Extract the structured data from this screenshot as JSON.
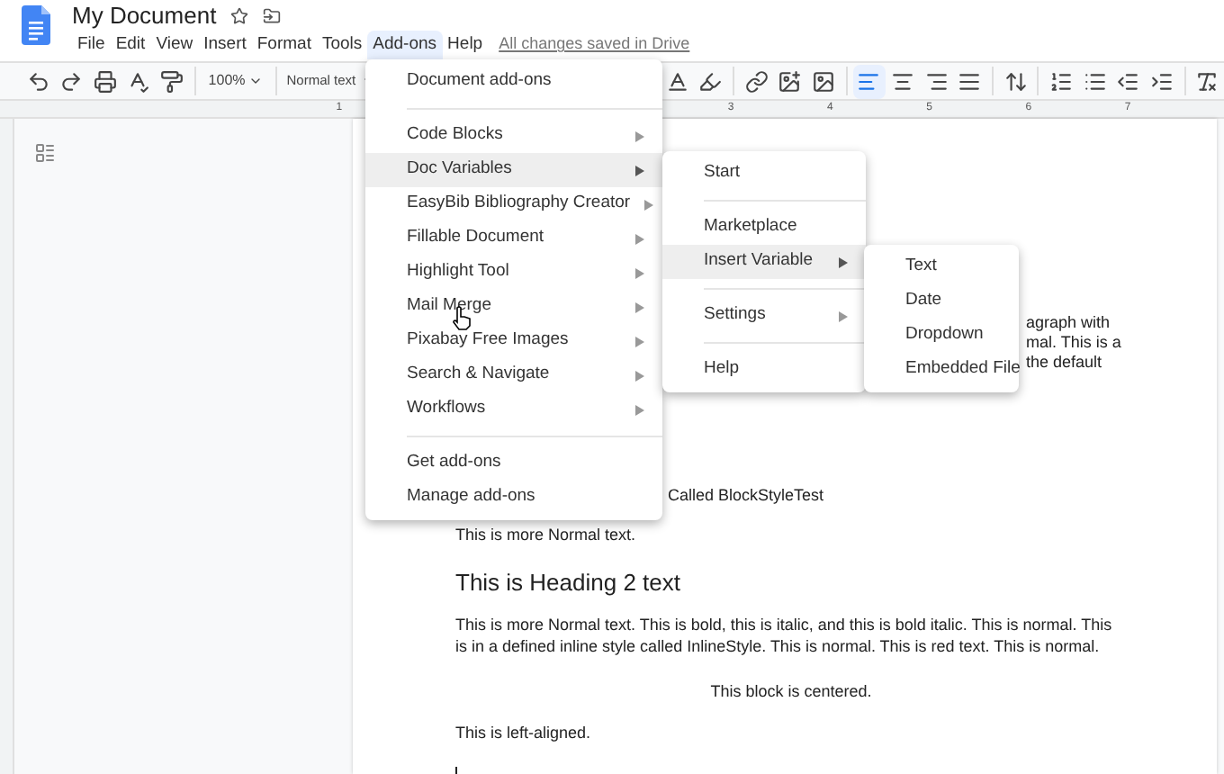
{
  "document_title": "My Document",
  "menu_bar": [
    {
      "label": "File",
      "selected": false
    },
    {
      "label": "Edit",
      "selected": false
    },
    {
      "label": "View",
      "selected": false
    },
    {
      "label": "Insert",
      "selected": false
    },
    {
      "label": "Format",
      "selected": false
    },
    {
      "label": "Tools",
      "selected": false
    },
    {
      "label": "Add-ons",
      "selected": true
    },
    {
      "label": "Help",
      "selected": false
    }
  ],
  "save_status": "All changes saved in Drive",
  "toolbar": {
    "zoom": "100%",
    "style": "Normal text",
    "alignments": [
      {
        "kind": "left",
        "selected": true
      },
      {
        "kind": "center",
        "selected": false
      },
      {
        "kind": "right",
        "selected": false
      },
      {
        "kind": "justify",
        "selected": false
      }
    ]
  },
  "ruler_labels": [
    "1",
    "3",
    "4",
    "5",
    "6",
    "7"
  ],
  "document": {
    "fragments": [
      "agraph with",
      "mal. This is a",
      "the default"
    ],
    "lines": [
      {
        "kind": "partial",
        "text": "Called BlockStyleTest"
      },
      {
        "kind": "normal",
        "text": "This is more Normal text."
      },
      {
        "kind": "heading",
        "text": "This is Heading 2 text"
      },
      {
        "kind": "normal",
        "text": "This is more Normal text. This is bold, this is italic, and this is bold italic. This is normal. This is in a defined inline style called InlineStyle. This is normal. This is red text. This is normal."
      },
      {
        "kind": "centered",
        "text": "This block is centered."
      },
      {
        "kind": "normal",
        "text": "This is left-aligned."
      }
    ]
  },
  "addons_menu": [
    {
      "kind": "item",
      "label": "Document add-ons",
      "submenu": false,
      "selected": false
    },
    {
      "kind": "separator"
    },
    {
      "kind": "item",
      "label": "Code Blocks",
      "submenu": true,
      "selected": false
    },
    {
      "kind": "item",
      "label": "Doc Variables",
      "submenu": true,
      "selected": true
    },
    {
      "kind": "item",
      "label": "EasyBib Bibliography Creator",
      "submenu": true,
      "selected": false
    },
    {
      "kind": "item",
      "label": "Fillable Document",
      "submenu": true,
      "selected": false
    },
    {
      "kind": "item",
      "label": "Highlight Tool",
      "submenu": true,
      "selected": false
    },
    {
      "kind": "item",
      "label": "Mail Merge",
      "submenu": true,
      "selected": false
    },
    {
      "kind": "item",
      "label": "Pixabay Free Images",
      "submenu": true,
      "selected": false
    },
    {
      "kind": "item",
      "label": "Search & Navigate",
      "submenu": true,
      "selected": false
    },
    {
      "kind": "item",
      "label": "Workflows",
      "submenu": true,
      "selected": false
    },
    {
      "kind": "separator"
    },
    {
      "kind": "item",
      "label": "Get add-ons",
      "submenu": false,
      "selected": false
    },
    {
      "kind": "item",
      "label": "Manage add-ons",
      "submenu": false,
      "selected": false
    }
  ],
  "doc_variables_menu": [
    {
      "kind": "item",
      "label": "Start",
      "submenu": false,
      "selected": false
    },
    {
      "kind": "separator"
    },
    {
      "kind": "item",
      "label": "Marketplace",
      "submenu": false,
      "selected": false
    },
    {
      "kind": "item",
      "label": "Insert Variable",
      "submenu": true,
      "selected": true
    },
    {
      "kind": "separator"
    },
    {
      "kind": "item",
      "label": "Settings",
      "submenu": true,
      "selected": false
    },
    {
      "kind": "separator"
    },
    {
      "kind": "item",
      "label": "Help",
      "submenu": false,
      "selected": false
    }
  ],
  "insert_variable_menu": [
    {
      "kind": "item",
      "label": "Text",
      "selected": false
    },
    {
      "kind": "item",
      "label": "Date",
      "selected": false
    },
    {
      "kind": "item",
      "label": "Dropdown",
      "selected": false
    },
    {
      "kind": "item",
      "label": "Embedded File",
      "selected": false
    }
  ]
}
